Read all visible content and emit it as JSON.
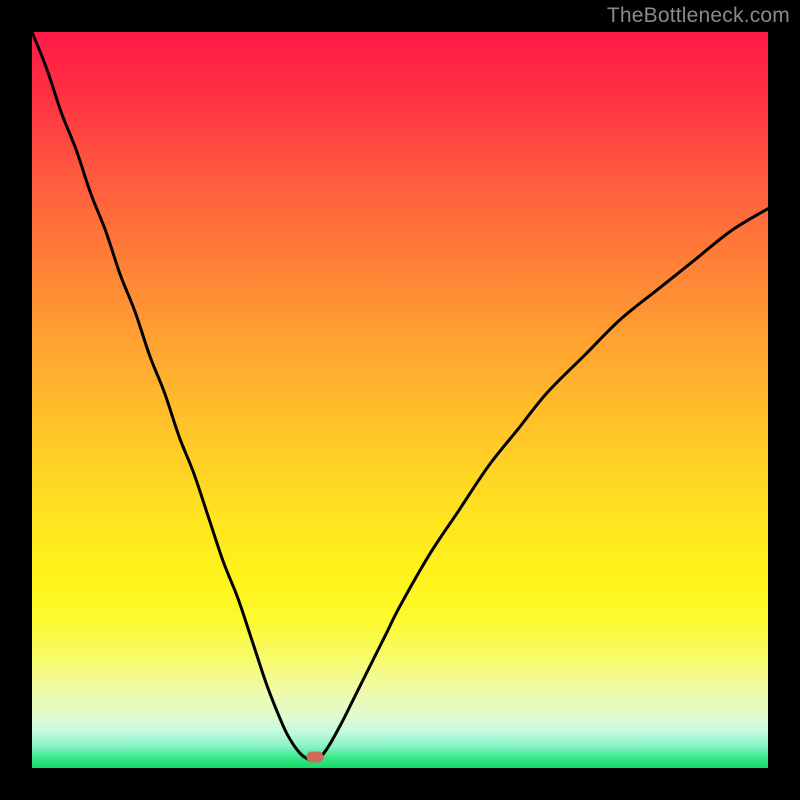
{
  "watermark": {
    "text": "TheBottleneck.com"
  },
  "chart_data": {
    "type": "line",
    "title": "",
    "xlabel": "",
    "ylabel": "",
    "xlim": [
      0,
      100
    ],
    "ylim": [
      0,
      100
    ],
    "grid": false,
    "legend": false,
    "annotations": [],
    "background_gradient": {
      "orientation": "vertical",
      "stops": [
        {
          "pos": 0.0,
          "color": "#ff1a49"
        },
        {
          "pos": 0.2,
          "color": "#ff5b3e"
        },
        {
          "pos": 0.44,
          "color": "#ffa830"
        },
        {
          "pos": 0.66,
          "color": "#ffe41f"
        },
        {
          "pos": 0.86,
          "color": "#f6fb76"
        },
        {
          "pos": 0.95,
          "color": "#c7fae0"
        },
        {
          "pos": 1.0,
          "color": "#14db65"
        }
      ]
    },
    "marker": {
      "x": 38.5,
      "y": 1.5,
      "color": "#cf6a5a"
    },
    "series": [
      {
        "name": "bottleneck-curve",
        "color": "#000000",
        "x": [
          0,
          2,
          4,
          6,
          8,
          10,
          12,
          14,
          16,
          18,
          20,
          22,
          24,
          26,
          28,
          30,
          32,
          34,
          35,
          36,
          37,
          38.5,
          40,
          42,
          44,
          46,
          48,
          50,
          54,
          58,
          62,
          66,
          70,
          75,
          80,
          85,
          90,
          95,
          100
        ],
        "y": [
          100,
          95,
          89,
          84,
          78,
          73,
          67,
          62,
          56,
          51,
          45,
          40,
          34,
          28,
          23,
          17,
          11,
          6,
          4,
          2.5,
          1.5,
          1,
          2.5,
          6,
          10,
          14,
          18,
          22,
          29,
          35,
          41,
          46,
          51,
          56,
          61,
          65,
          69,
          73,
          76
        ]
      }
    ]
  }
}
